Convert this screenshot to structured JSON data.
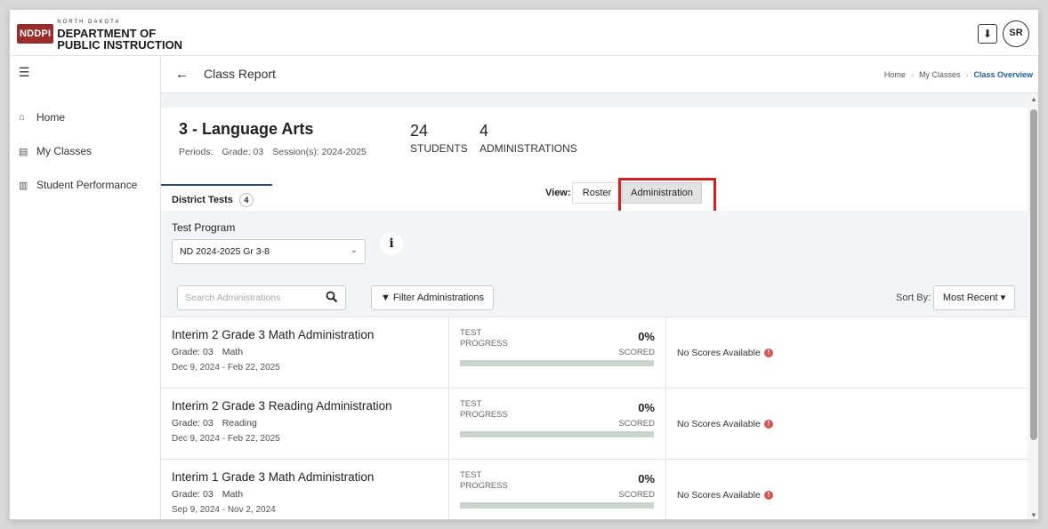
{
  "header": {
    "logo_badge": "NDDPI",
    "logo_small": "NORTH DAKOTA",
    "logo_line1": "DEPARTMENT OF",
    "logo_line2": "PUBLIC INSTRUCTION",
    "avatar_initials": "SR",
    "download_icon": "download-icon"
  },
  "sidebar": {
    "menu_icon": "menu-icon",
    "items": [
      {
        "label": "Home",
        "icon": "home-icon"
      },
      {
        "label": "My Classes",
        "icon": "classes-icon"
      },
      {
        "label": "Student Performance",
        "icon": "bar-chart-icon"
      }
    ]
  },
  "page": {
    "title": "Class Report",
    "breadcrumb": [
      "Home",
      "My Classes",
      "Class Overview"
    ]
  },
  "class_info": {
    "name": "3 - Language Arts",
    "periods_label": "Periods:",
    "grade": "Grade: 03",
    "session": "Session(s): 2024-2025",
    "students_count": "24",
    "students_label": "STUDENTS",
    "admins_count": "4",
    "admins_label": "ADMINISTRATIONS"
  },
  "tabs": {
    "district_tests": "District Tests",
    "district_count": "4"
  },
  "view": {
    "label": "View:",
    "roster": "Roster",
    "administration": "Administration"
  },
  "filters": {
    "test_program_label": "Test Program",
    "test_program_value": "ND 2024-2025 Gr 3-8",
    "info_glyph": "i",
    "search_placeholder": "Search Administrations",
    "filter_button": "Filter Administrations",
    "sort_label": "Sort By:",
    "sort_value": "Most Recent"
  },
  "administrations": [
    {
      "title": "Interim 2 Grade 3 Math Administration",
      "grade": "Grade: 03",
      "subject": "Math",
      "dates": "Dec 9, 2024 - Feb 22, 2025",
      "progress_label_1": "TEST",
      "progress_label_2": "PROGRESS",
      "percent": "0%",
      "scored_label": "SCORED",
      "progress_value": 0,
      "status": "No Scores Available"
    },
    {
      "title": "Interim 2 Grade 3 Reading Administration",
      "grade": "Grade: 03",
      "subject": "Reading",
      "dates": "Dec 9, 2024 - Feb 22, 2025",
      "progress_label_1": "TEST",
      "progress_label_2": "PROGRESS",
      "percent": "0%",
      "scored_label": "SCORED",
      "progress_value": 0,
      "status": "No Scores Available"
    },
    {
      "title": "Interim 1 Grade 3 Math Administration",
      "grade": "Grade: 03",
      "subject": "Math",
      "dates": "Sep 9, 2024 - Nov 2, 2024",
      "progress_label_1": "TEST",
      "progress_label_2": "PROGRESS",
      "percent": "0%",
      "scored_label": "SCORED",
      "progress_value": 0,
      "status": "No Scores Available"
    }
  ],
  "colors": {
    "brand_red": "#9b2c2c",
    "highlight": "#d32020",
    "breadcrumb_active": "#1f5fa8",
    "warning": "#d9534f"
  }
}
